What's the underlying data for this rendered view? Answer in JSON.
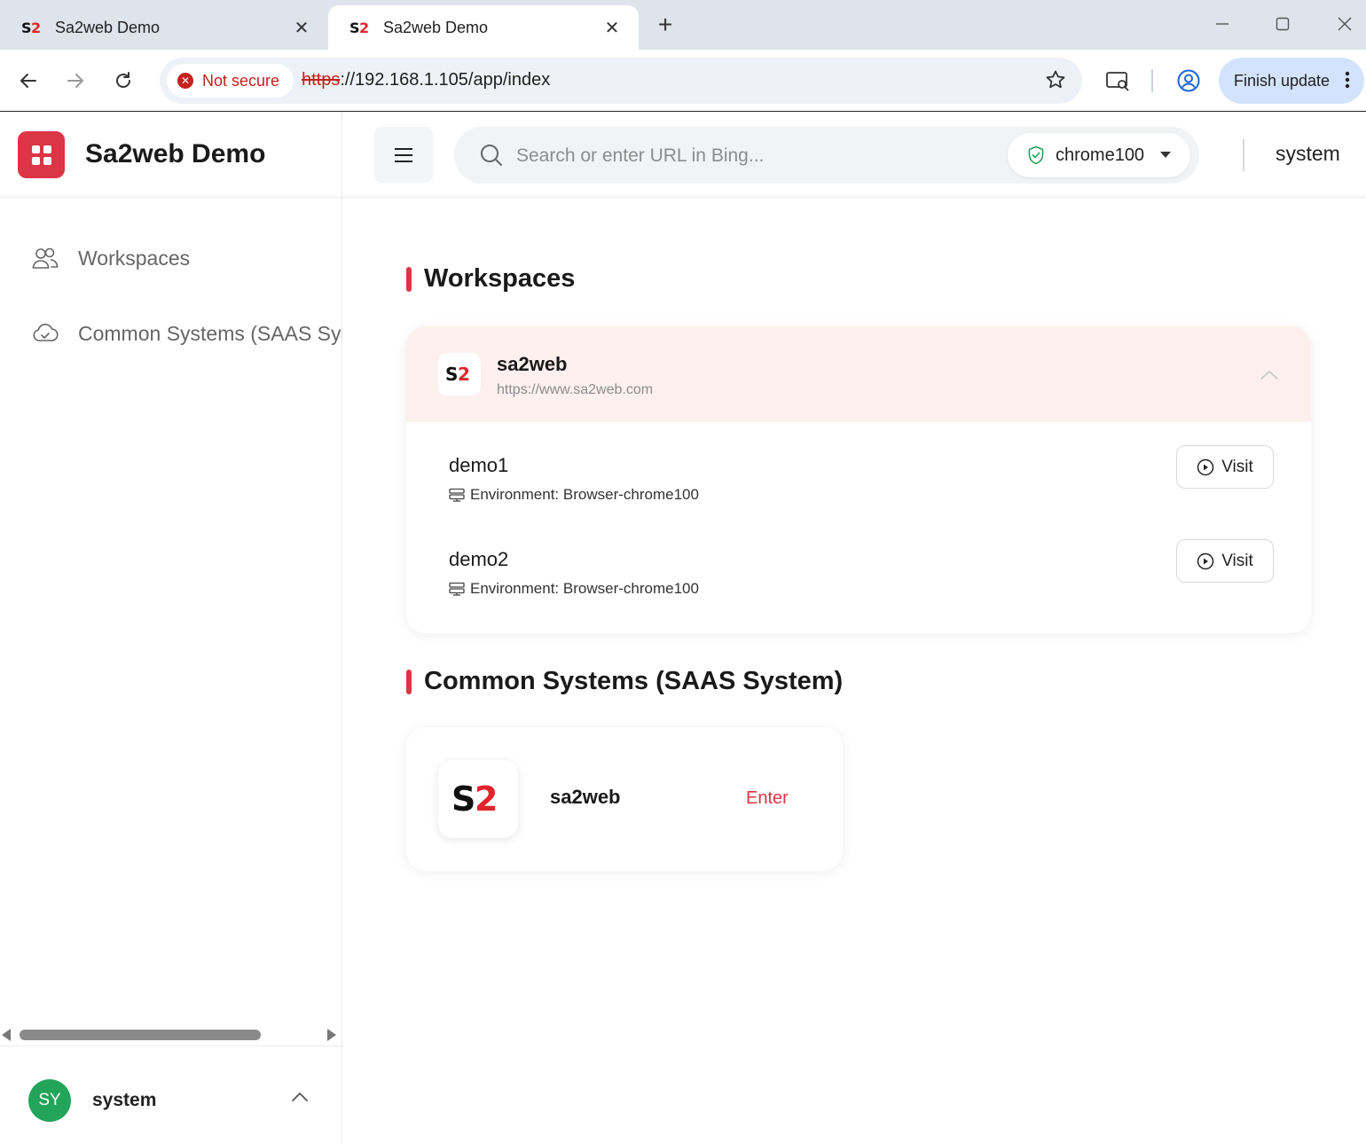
{
  "browser": {
    "tabs": [
      {
        "title": "Sa2web Demo",
        "active": false
      },
      {
        "title": "Sa2web Demo",
        "active": true
      }
    ],
    "security_chip": "Not secure",
    "url_scheme": "https",
    "url_rest": "://192.168.1.105/app/index",
    "finish_update": "Finish update",
    "colors": {
      "warning": "#c5221f",
      "finish_bg": "#d3e3fd"
    }
  },
  "app": {
    "brand_name": "Sa2web Demo",
    "accent_color": "#dc3545",
    "sidebar": {
      "items": [
        {
          "label": "Workspaces",
          "icon": "users-icon"
        },
        {
          "label": "Common Systems (SAAS System)",
          "icon": "cloud-icon"
        }
      ]
    },
    "user": {
      "initials": "SY",
      "name": "system",
      "avatar_color": "#22a55a"
    },
    "topbar": {
      "search_placeholder": "Search or enter URL in Bing...",
      "environment": "chrome100",
      "user": "system"
    },
    "workspaces": {
      "title": "Workspaces",
      "group": {
        "name": "sa2web",
        "url": "https://www.sa2web.com",
        "items": [
          {
            "name": "demo1",
            "environment": "Environment: Browser-chrome100",
            "action": "Visit"
          },
          {
            "name": "demo2",
            "environment": "Environment: Browser-chrome100",
            "action": "Visit"
          }
        ]
      }
    },
    "common_systems": {
      "title": "Common Systems (SAAS System)",
      "items": [
        {
          "name": "sa2web",
          "action": "Enter"
        }
      ]
    }
  }
}
